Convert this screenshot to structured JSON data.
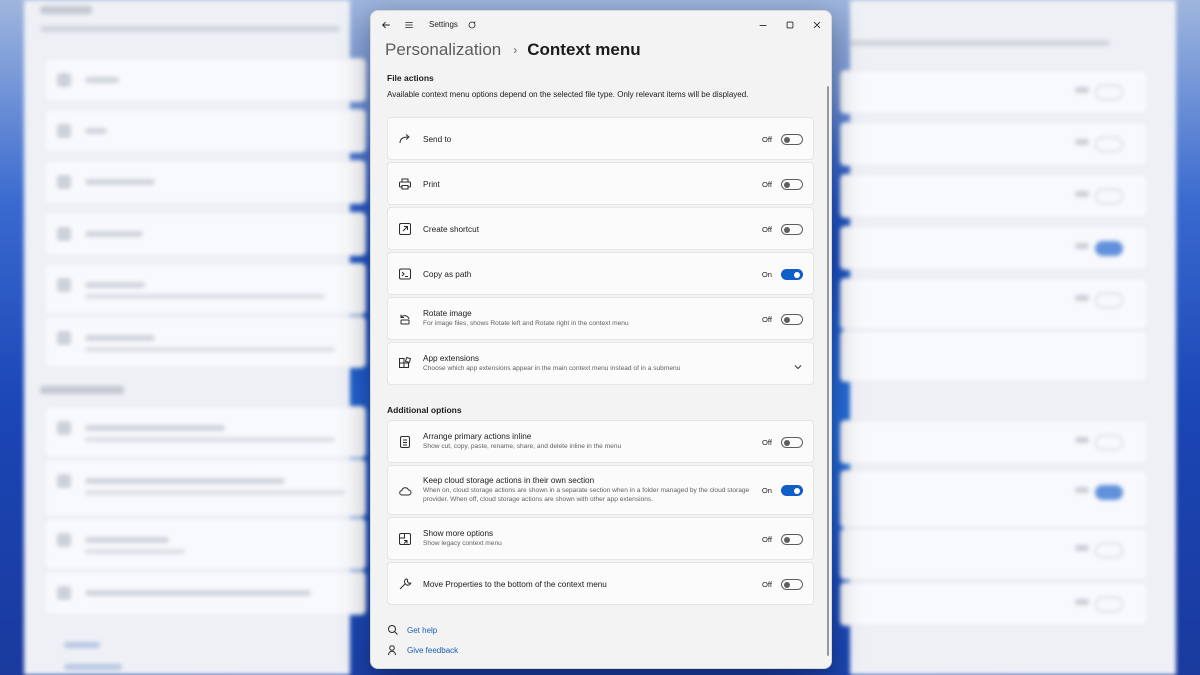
{
  "window": {
    "title": "Settings",
    "back_icon": "back-arrow-icon",
    "menu_icon": "hamburger-menu-icon",
    "extra_icon": "refresh-icon"
  },
  "breadcrumb": {
    "parent": "Personalization",
    "separator": "›",
    "current": "Context menu"
  },
  "file_actions": {
    "title": "File actions",
    "description": "Available context menu options depend on the selected file type. Only relevant items will be displayed.",
    "items": [
      {
        "label": "Send to",
        "state": "Off",
        "on": false,
        "icon": "send-icon"
      },
      {
        "label": "Print",
        "state": "Off",
        "on": false,
        "icon": "printer-icon"
      },
      {
        "label": "Create shortcut",
        "state": "Off",
        "on": false,
        "icon": "shortcut-icon"
      },
      {
        "label": "Copy as path",
        "state": "On",
        "on": true,
        "icon": "copy-path-icon"
      },
      {
        "label": "Rotate image",
        "sub": "For image files, shows Rotate left and Rotate right in the context menu",
        "state": "Off",
        "on": false,
        "icon": "rotate-icon"
      },
      {
        "label": "App extensions",
        "sub": "Choose which app extensions appear in the main context menu instead of in a submenu",
        "icon": "apps-icon",
        "expander": true
      }
    ]
  },
  "additional_options": {
    "title": "Additional options",
    "items": [
      {
        "label": "Arrange primary actions inline",
        "sub": "Show cut, copy, paste, rename, share, and delete inline in the menu",
        "state": "Off",
        "on": false,
        "icon": "list-icon"
      },
      {
        "label": "Keep cloud storage actions in their own section",
        "sub": "When on, cloud storage actions are shown in a separate section when in a folder managed by the cloud storage provider. When off, cloud storage actions are shown with other app extensions.",
        "state": "On",
        "on": true,
        "icon": "cloud-icon"
      },
      {
        "label": "Show more options",
        "sub": "Show legacy context menu",
        "state": "Off",
        "on": false,
        "icon": "more-options-icon"
      },
      {
        "label": "Move Properties to the bottom of the context menu",
        "state": "Off",
        "on": false,
        "icon": "wrench-icon"
      }
    ]
  },
  "links": {
    "help": "Get help",
    "feedback": "Give feedback"
  },
  "colors": {
    "accent": "#0f5fc9",
    "link": "#1a5fb4"
  }
}
